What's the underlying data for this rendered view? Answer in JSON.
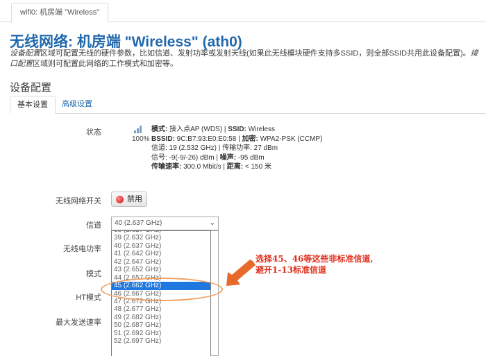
{
  "top_tab": {
    "label": "wifi0: 机房端 \"Wireless\""
  },
  "header": {
    "title": "无线网络: 机房端 \"Wireless\" (ath0)"
  },
  "description": {
    "part1": "设备配置",
    "part2": "区域可配置无线的硬件参数，比如信道、发射功率或发射天线(如果此无线模块硬件支持多SSID，则全部SSID共用此设备配置)。",
    "part3": "接口配置",
    "part4": "区域则可配置此网络的工作模式和加密等。"
  },
  "section": {
    "title": "设备配置"
  },
  "tabs": [
    {
      "label": "基本设置"
    },
    {
      "label": "高级设置"
    }
  ],
  "labels": {
    "status": "状态",
    "wireless_switch": "无线网络开关",
    "channel": "信道",
    "tx_power": "无线电功率",
    "mode": "模式",
    "ht_mode": "HT模式",
    "max_rate": "最大发送速率"
  },
  "status": {
    "signal_percent": "100%",
    "l1k1": "模式:",
    "l1v1": " 接入点AP (WDS) | ",
    "l1k2": "SSID:",
    "l1v2": " Wireless",
    "l2k1": "BSSID:",
    "l2v1": " 9C:B7:93:E0:E0:58 | ",
    "l2k2": "加密:",
    "l2v2": " WPA2-PSK (CCMP)",
    "l3k1": "信道:",
    "l3v1": " 19 (2.532 GHz) | ",
    "l3k2": "传输功率:",
    "l3v2": " 27 dBm",
    "l4k1": "信号:",
    "l4v1": " -9(-9/-26) dBm | ",
    "l4k2": "噪声:",
    "l4v2": " -95 dBm",
    "l5k1": "传输速率:",
    "l5v1": " 300.0 Mbit/s | ",
    "l5k2": "距离:",
    "l5v2": " < 150 米"
  },
  "buttons": {
    "disable": "禁用"
  },
  "channel": {
    "selected": "40 (2.637 GHz)",
    "options": [
      "38 (2.627 GHz)",
      "39 (2.632 GHz)",
      "40 (2.637 GHz)",
      "41 (2.642 GHz)",
      "42 (2.647 GHz)",
      "43 (2.652 GHz)",
      "44 (2.657 GHz)",
      "45 (2.662 GHz)",
      "46 (2.667 GHz)",
      "47 (2.672 GHz)",
      "48 (2.677 GHz)",
      "49 (2.682 GHz)",
      "50 (2.687 GHz)",
      "51 (2.692 GHz)",
      "52 (2.697 GHz)"
    ],
    "highlighted_option": "45 (2.662 GHz)"
  },
  "annotation": {
    "line1": "选择45、46等这些非标准信道,",
    "line2": "避开1-13标准信道"
  },
  "colors": {
    "title_blue": "#2168ad",
    "annotation_red": "#e0301e",
    "ellipse_orange": "#f0a060",
    "selection_blue": "#1e78e0"
  }
}
